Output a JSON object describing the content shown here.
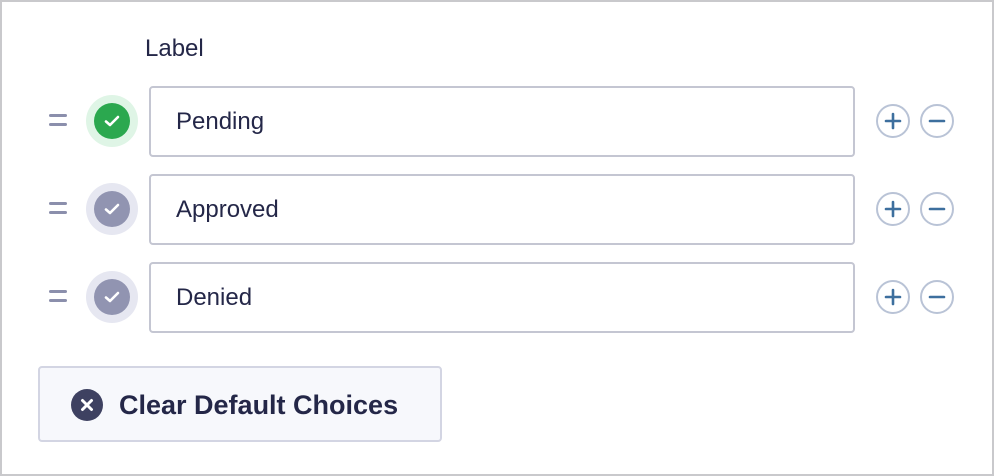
{
  "field": {
    "column_label": "Label",
    "choices": [
      {
        "label": "Pending",
        "is_default": true
      },
      {
        "label": "Approved",
        "is_default": false
      },
      {
        "label": "Denied",
        "is_default": false
      }
    ]
  },
  "actions": {
    "clear_defaults_label": "Clear Default Choices"
  },
  "icons": {
    "drag": "drag-handle-icon",
    "check": "check-icon",
    "add": "plus-icon",
    "remove": "minus-icon",
    "clear": "x-circle-icon"
  },
  "colors": {
    "default_selected": "#2ba84f",
    "default_selected_halo": "#dff5e6",
    "default_unselected": "#9194b1",
    "default_unselected_halo": "#e6e7f1",
    "add_remove_icon": "#3d6f9e",
    "text": "#242748"
  }
}
